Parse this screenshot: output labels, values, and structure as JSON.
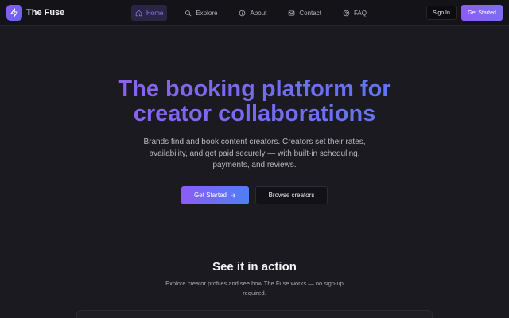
{
  "brand": {
    "name": "The Fuse",
    "logo_icon": "lightning-icon",
    "accent": "#8b5cf6"
  },
  "nav": {
    "items": [
      {
        "label": "Home",
        "icon": "home-icon",
        "active": true
      },
      {
        "label": "Explore",
        "icon": "search-icon",
        "active": false
      },
      {
        "label": "About",
        "icon": "info-icon",
        "active": false
      },
      {
        "label": "Contact",
        "icon": "mail-icon",
        "active": false
      },
      {
        "label": "FAQ",
        "icon": "help-circle-icon",
        "active": false
      }
    ],
    "signin_label": "Sign In",
    "getstarted_label": "Get Started"
  },
  "hero": {
    "title_line1": "The booking platform for",
    "title_line2": "creator collaborations",
    "subtitle": "Brands find and book content creators. Creators set their rates, availability, and get paid securely — with built-in scheduling, payments, and reviews.",
    "primary_label": "Get Started",
    "primary_icon": "arrow-right-icon",
    "secondary_label": "Browse creators"
  },
  "demo": {
    "title": "See it in action",
    "subtitle": "Explore creator profiles and see how The Fuse works — no sign-up required."
  },
  "colors": {
    "background": "#1b1a20",
    "navbar": "#141318",
    "gradient_start": "#9b5cf0",
    "gradient_end": "#4d7ef0"
  }
}
